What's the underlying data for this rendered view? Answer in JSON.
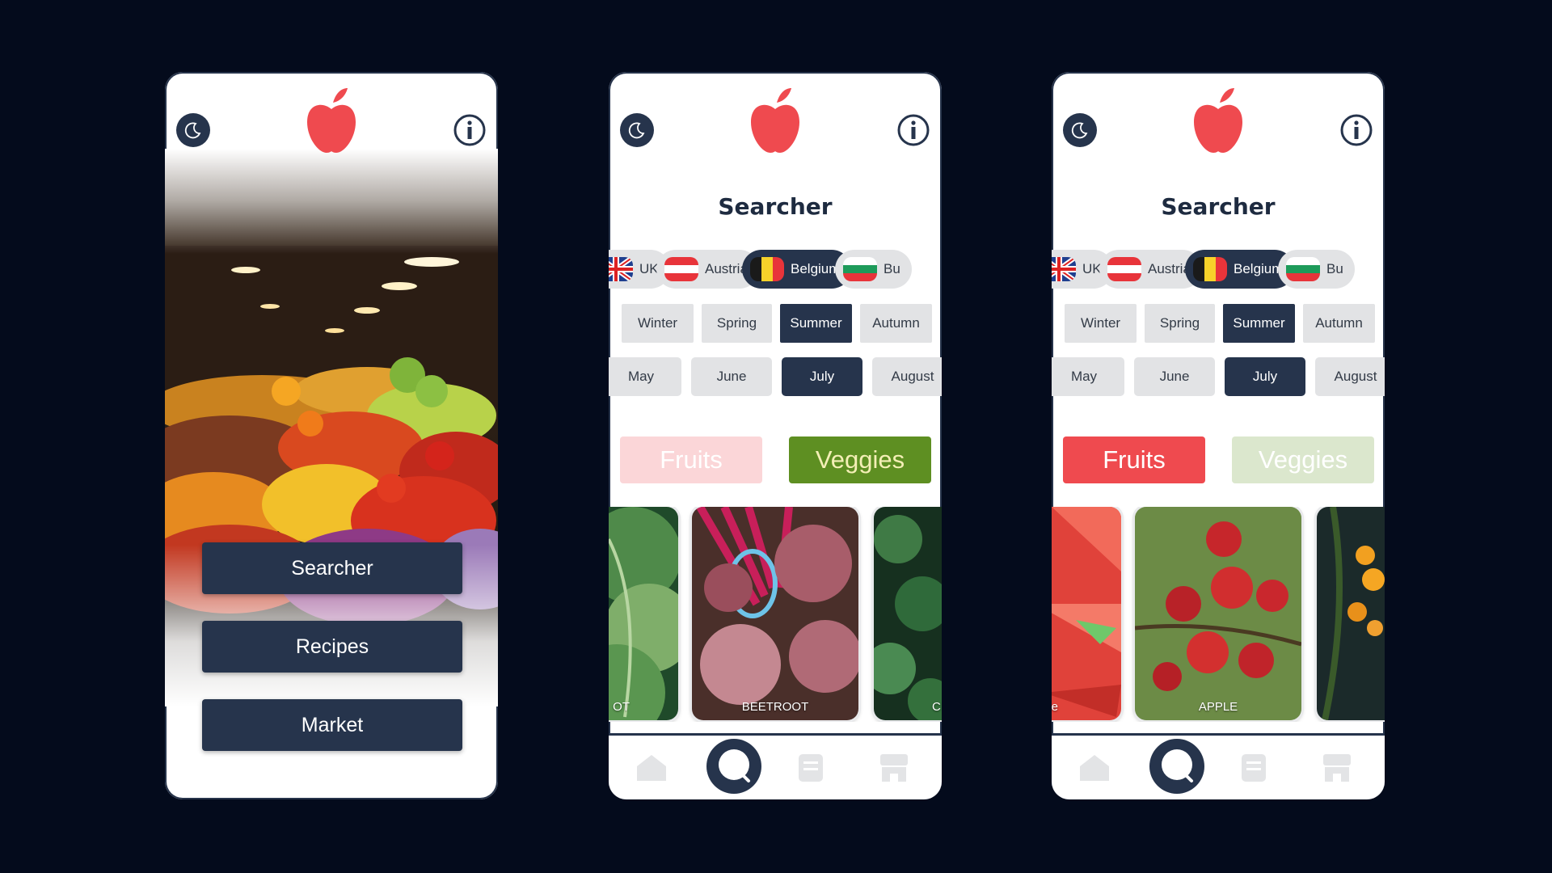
{
  "colors": {
    "background": "#040b1c",
    "navy": "#26344c",
    "apple_red": "#ef4a4f",
    "fruits_red": "#ef4a4f",
    "veggies_green": "#5e8f22",
    "chip_grey": "#e2e3e5"
  },
  "icons": {
    "theme": "moon-icon",
    "info": "info-icon",
    "logo": "apple-logo",
    "home": "home-icon",
    "search": "search-icon",
    "recipes": "recipe-book-icon",
    "market": "market-icon"
  },
  "home": {
    "menu": [
      "Searcher",
      "Recipes",
      "Market"
    ]
  },
  "searcher": {
    "title": "Searcher",
    "countries": [
      "UK",
      "Austria",
      "Belgium",
      "Bu"
    ],
    "selected_country": "Belgium",
    "seasons": [
      "Winter",
      "Spring",
      "Summer",
      "Autumn"
    ],
    "selected_season": "Summer",
    "months": [
      "May",
      "June",
      "July",
      "August"
    ],
    "selected_month": "July",
    "categories": [
      "Fruits",
      "Veggies"
    ]
  },
  "screen2": {
    "active_category": "Veggies",
    "cards": [
      "OT",
      "BEETROOT",
      "C"
    ]
  },
  "screen3": {
    "active_category": "Fruits",
    "cards": [
      "e",
      "APPLE",
      ""
    ]
  }
}
